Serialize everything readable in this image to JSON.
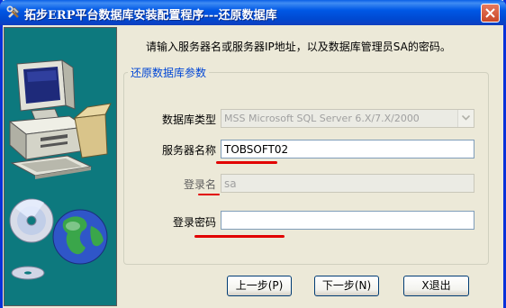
{
  "window": {
    "title": "拓步ERP平台数据库安装配置程序---还原数据库",
    "colors": {
      "titlebar": "#0054E3",
      "face": "#ECE9D8",
      "panel": "#0D797E",
      "group_title": "#0046D5",
      "annotation": "#E10000"
    }
  },
  "intro": "请输入服务器名或服务器IP地址，以及数据库管理员SA的密码。",
  "group": {
    "title": "还原数据库参数",
    "db_type": {
      "label": "数据库类型",
      "value": "MSS Microsoft SQL Server 6.X/7.X/2000"
    },
    "server": {
      "label": "服务器名称",
      "value": "TOBSOFT02"
    },
    "login": {
      "label": "登录名",
      "value": "sa"
    },
    "password": {
      "label": "登录密码",
      "value": ""
    }
  },
  "buttons": {
    "prev": "上一步(P)",
    "next": "下一步(N)",
    "exit": "X退出"
  },
  "icons": [
    "tools-icon",
    "close-icon",
    "computer-illustration",
    "cd-disc-icon",
    "globe-icon",
    "dropdown-arrow-icon"
  ]
}
